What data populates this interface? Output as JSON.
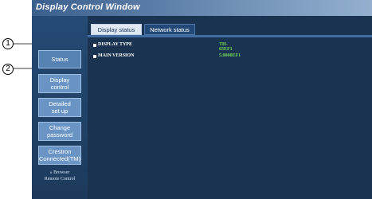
{
  "window": {
    "title": "Display Control Window"
  },
  "sidebar": {
    "items": [
      {
        "label": "Status"
      },
      {
        "label": "Display\ncontrol"
      },
      {
        "label": "Detailed\nset up"
      },
      {
        "label": "Change\npassword"
      },
      {
        "label": "Crestron\nConnected(TM)"
      }
    ],
    "link": "» Browser\nRemote Control"
  },
  "tabs": [
    {
      "label": "Display status"
    },
    {
      "label": "Network status"
    }
  ],
  "display_status": [
    {
      "label": "DISPLAY TYPE",
      "value": "TH-65EF1"
    },
    {
      "label": "MAIN VERSION",
      "value": "5.0000EF1"
    }
  ],
  "callouts": [
    "1",
    "2"
  ]
}
